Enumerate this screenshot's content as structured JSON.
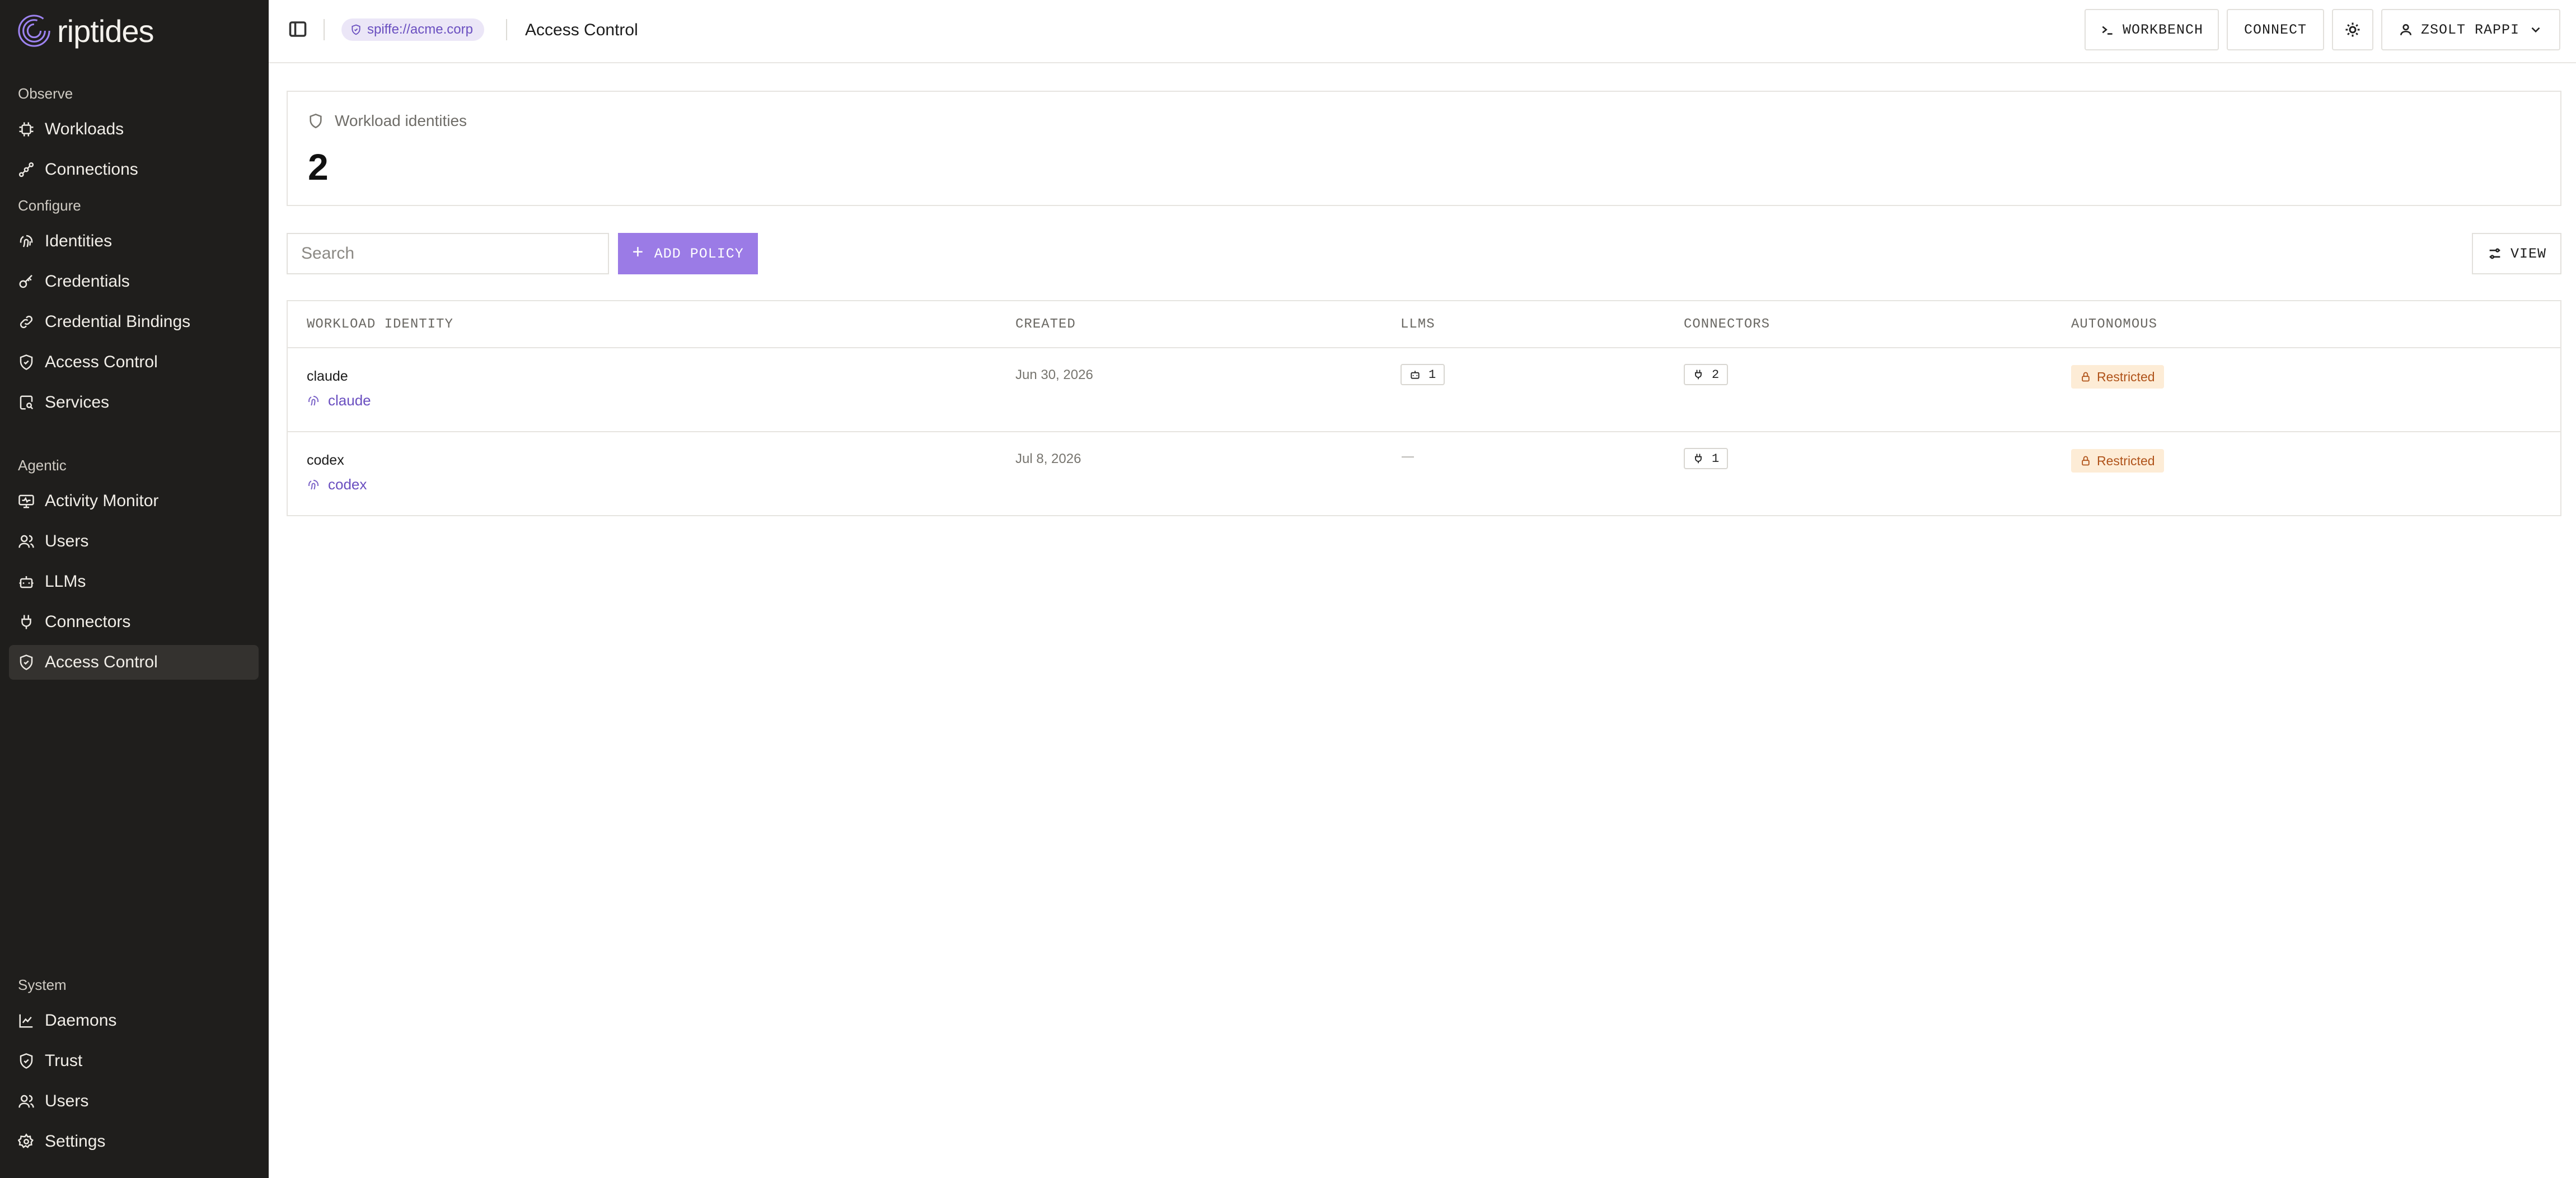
{
  "brand": {
    "name": "riptides"
  },
  "sidebar": {
    "sections": [
      {
        "label": "Observe",
        "items": [
          {
            "label": "Workloads",
            "icon": "cpu-icon"
          },
          {
            "label": "Connections",
            "icon": "connections-icon"
          }
        ]
      },
      {
        "label": "Configure",
        "items": [
          {
            "label": "Identities",
            "icon": "fingerprint-icon"
          },
          {
            "label": "Credentials",
            "icon": "key-icon"
          },
          {
            "label": "Credential Bindings",
            "icon": "link-icon"
          },
          {
            "label": "Access Control",
            "icon": "shield-check-icon"
          },
          {
            "label": "Services",
            "icon": "service-search-icon"
          }
        ]
      },
      {
        "label": "Agentic",
        "items": [
          {
            "label": "Activity Monitor",
            "icon": "monitor-icon"
          },
          {
            "label": "Users",
            "icon": "users-icon"
          },
          {
            "label": "LLMs",
            "icon": "bot-icon"
          },
          {
            "label": "Connectors",
            "icon": "plug-icon"
          },
          {
            "label": "Access Control",
            "icon": "shield-check-icon",
            "active": true
          }
        ]
      },
      {
        "label": "System",
        "items": [
          {
            "label": "Daemons",
            "icon": "chart-line-icon"
          },
          {
            "label": "Trust",
            "icon": "shield-icon"
          },
          {
            "label": "Users",
            "icon": "users-icon"
          },
          {
            "label": "Settings",
            "icon": "gear-icon"
          }
        ]
      }
    ]
  },
  "topbar": {
    "trust_domain": "spiffe://acme.corp",
    "page_title": "Access Control",
    "workbench_label": "WORKBENCH",
    "connect_label": "CONNECT",
    "user_label": "ZSOLT RAPPI"
  },
  "summary": {
    "label": "Workload identities",
    "value": "2"
  },
  "toolbar": {
    "search_placeholder": "Search",
    "add_label": "ADD POLICY",
    "view_label": "VIEW"
  },
  "table": {
    "headers": [
      "WORKLOAD IDENTITY",
      "CREATED",
      "LLMS",
      "CONNECTORS",
      "AUTONOMOUS"
    ],
    "rows": [
      {
        "name": "claude",
        "identity": "claude",
        "created": "Jun 30, 2026",
        "llms": "1",
        "connectors": "2",
        "autonomous": "Restricted"
      },
      {
        "name": "codex",
        "identity": "codex",
        "created": "Jul 8, 2026",
        "llms": "—",
        "connectors": "1",
        "autonomous": "Restricted"
      }
    ]
  },
  "colors": {
    "accent": "#9b7be6",
    "sidebar_bg": "#1f1e1c",
    "restricted_bg": "#fdecd6",
    "restricted_fg": "#b0531a"
  }
}
